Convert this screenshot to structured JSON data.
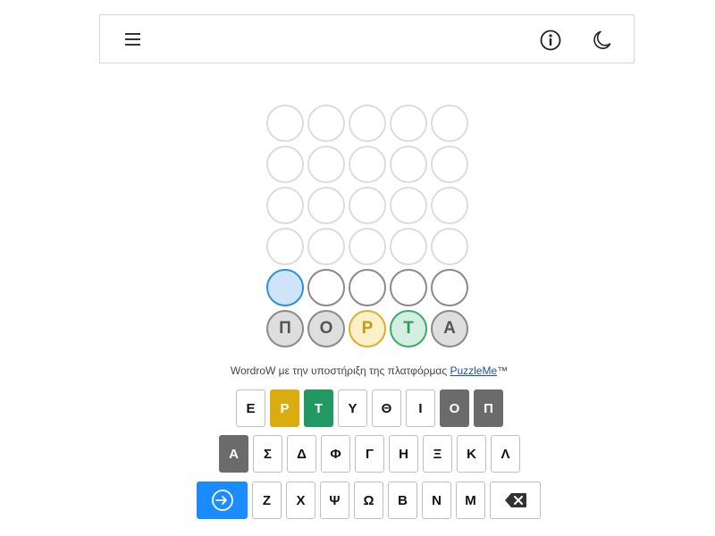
{
  "header": {
    "menu_icon": "hamburger-icon",
    "info_icon": "info-icon",
    "theme_icon": "moon-icon"
  },
  "board": {
    "rows": [
      [
        {
          "letter": "",
          "state": "empty"
        },
        {
          "letter": "",
          "state": "empty"
        },
        {
          "letter": "",
          "state": "empty"
        },
        {
          "letter": "",
          "state": "empty"
        },
        {
          "letter": "",
          "state": "empty"
        }
      ],
      [
        {
          "letter": "",
          "state": "empty"
        },
        {
          "letter": "",
          "state": "empty"
        },
        {
          "letter": "",
          "state": "empty"
        },
        {
          "letter": "",
          "state": "empty"
        },
        {
          "letter": "",
          "state": "empty"
        }
      ],
      [
        {
          "letter": "",
          "state": "empty"
        },
        {
          "letter": "",
          "state": "empty"
        },
        {
          "letter": "",
          "state": "empty"
        },
        {
          "letter": "",
          "state": "empty"
        },
        {
          "letter": "",
          "state": "empty"
        }
      ],
      [
        {
          "letter": "",
          "state": "empty"
        },
        {
          "letter": "",
          "state": "empty"
        },
        {
          "letter": "",
          "state": "empty"
        },
        {
          "letter": "",
          "state": "empty"
        },
        {
          "letter": "",
          "state": "empty"
        }
      ],
      [
        {
          "letter": "",
          "state": "cursor"
        },
        {
          "letter": "",
          "state": "active-row"
        },
        {
          "letter": "",
          "state": "active-row"
        },
        {
          "letter": "",
          "state": "active-row"
        },
        {
          "letter": "",
          "state": "active-row"
        }
      ],
      [
        {
          "letter": "Π",
          "state": "absent"
        },
        {
          "letter": "Ο",
          "state": "absent"
        },
        {
          "letter": "Ρ",
          "state": "present"
        },
        {
          "letter": "Τ",
          "state": "correct"
        },
        {
          "letter": "Α",
          "state": "absent"
        }
      ]
    ]
  },
  "credit": {
    "text": "WordroW με την υποστήριξη της πλατφόρμας ",
    "link": "PuzzleMe",
    "suffix": "™"
  },
  "keyboard": {
    "row1": [
      {
        "label": "Ε",
        "state": "default"
      },
      {
        "label": "Ρ",
        "state": "present"
      },
      {
        "label": "Τ",
        "state": "correct"
      },
      {
        "label": "Υ",
        "state": "default"
      },
      {
        "label": "Θ",
        "state": "default"
      },
      {
        "label": "Ι",
        "state": "default"
      },
      {
        "label": "Ο",
        "state": "absent"
      },
      {
        "label": "Π",
        "state": "absent"
      }
    ],
    "row2": [
      {
        "label": "Α",
        "state": "absent"
      },
      {
        "label": "Σ",
        "state": "default"
      },
      {
        "label": "Δ",
        "state": "default"
      },
      {
        "label": "Φ",
        "state": "default"
      },
      {
        "label": "Γ",
        "state": "default"
      },
      {
        "label": "Η",
        "state": "default"
      },
      {
        "label": "Ξ",
        "state": "default"
      },
      {
        "label": "Κ",
        "state": "default"
      },
      {
        "label": "Λ",
        "state": "default"
      }
    ],
    "row3": [
      {
        "label": "Ζ",
        "state": "default"
      },
      {
        "label": "Χ",
        "state": "default"
      },
      {
        "label": "Ψ",
        "state": "default"
      },
      {
        "label": "Ω",
        "state": "default"
      },
      {
        "label": "Β",
        "state": "default"
      },
      {
        "label": "Ν",
        "state": "default"
      },
      {
        "label": "Μ",
        "state": "default"
      }
    ],
    "enter_icon": "enter-icon",
    "backspace_icon": "backspace-icon"
  },
  "colors": {
    "present": "#d9ac0f",
    "correct": "#229960",
    "absent": "#6b6b6b",
    "enter": "#1a8cff",
    "cursor": "#2e8fdb"
  }
}
